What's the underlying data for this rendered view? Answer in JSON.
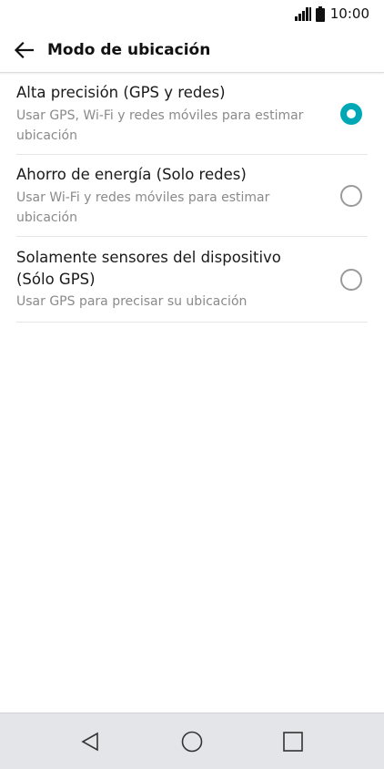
{
  "status_bar": {
    "time": "10:00",
    "icons": [
      "signal-icon",
      "battery-icon"
    ]
  },
  "header": {
    "title": "Modo de ubicación",
    "back_icon": "back-arrow-icon"
  },
  "options": [
    {
      "title": "Alta precisión (GPS y redes)",
      "summary": "Usar GPS, Wi-Fi y redes móviles para estimar ubicación",
      "selected": true
    },
    {
      "title": "Ahorro de energía (Solo redes)",
      "summary": "Usar Wi-Fi y redes móviles para estimar ubicación",
      "selected": false
    },
    {
      "title": "Solamente sensores del dispositivo (Sólo GPS)",
      "summary": "Usar GPS para precisar su ubicación",
      "selected": false
    }
  ],
  "nav_bar": {
    "buttons": [
      "nav-back-icon",
      "nav-home-icon",
      "nav-recents-icon"
    ]
  },
  "colors": {
    "accent": "#00a7b5",
    "summary_text": "#8a8a8a",
    "nav_background": "#e3e5e8"
  }
}
